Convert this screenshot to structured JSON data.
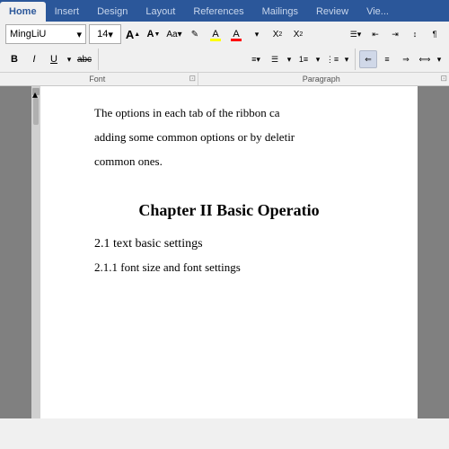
{
  "tabs": [
    {
      "label": "Home",
      "active": true
    },
    {
      "label": "Insert",
      "active": false
    },
    {
      "label": "Design",
      "active": false
    },
    {
      "label": "Layout",
      "active": false
    },
    {
      "label": "References",
      "active": false
    },
    {
      "label": "Mailings",
      "active": false
    },
    {
      "label": "Review",
      "active": false
    },
    {
      "label": "Vie...",
      "active": false
    }
  ],
  "toolbar": {
    "font_name": "MingLiU",
    "font_size": "14",
    "font_section_label": "Font",
    "paragraph_section_label": "Paragraph"
  },
  "buttons": {
    "bold": "B",
    "italic": "I",
    "underline": "U",
    "strikethrough": "abc",
    "subscript": "X₂",
    "superscript": "X²",
    "increase_font": "A",
    "decrease_font": "A",
    "change_case": "Aa",
    "highlight": "ab",
    "font_color": "A",
    "clear_format": "◌"
  },
  "document": {
    "text_line1": "The options in each tab of the ribbon ca",
    "text_line2": "adding some common options or by deletir",
    "text_line3": "common ones.",
    "chapter_heading": "Chapter II Basic Operatio",
    "section1": "2.1 text basic settings",
    "section2": "2.1.1 font size and font settings"
  }
}
